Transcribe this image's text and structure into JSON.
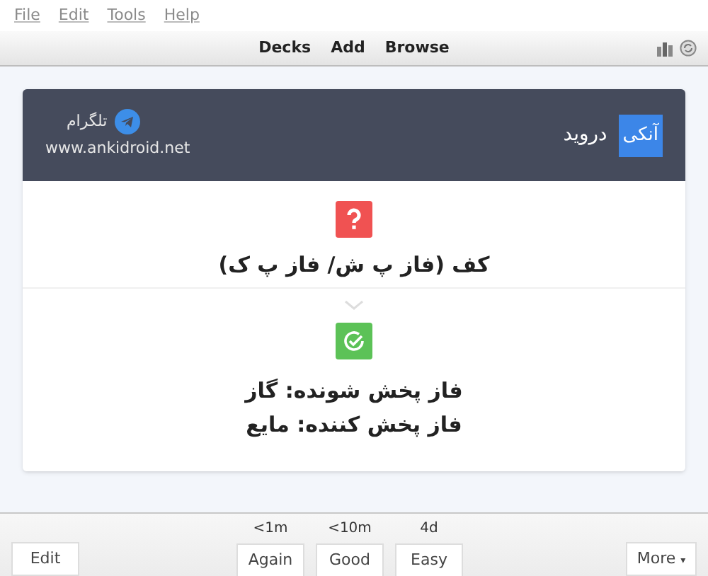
{
  "menu": [
    "File",
    "Edit",
    "Tools",
    "Help"
  ],
  "toolbar": [
    "Decks",
    "Add",
    "Browse"
  ],
  "card": {
    "header": {
      "logo_badge": "آنکی",
      "logo_text": "درويد",
      "telegram": "تلگرام",
      "website": "www.ankidroid.net"
    },
    "question": "کف (فاز پ ش/ فاز پ ک)",
    "answer_lines": [
      "فاز پخش شونده: گاز",
      "فاز پخش کننده: مایع"
    ]
  },
  "bottom": {
    "edit": "Edit",
    "answers": [
      {
        "interval": "<1m",
        "label": "Again"
      },
      {
        "interval": "<10m",
        "label": "Good"
      },
      {
        "interval": "4d",
        "label": "Easy"
      }
    ],
    "more": "More",
    "more_caret": "▾"
  }
}
